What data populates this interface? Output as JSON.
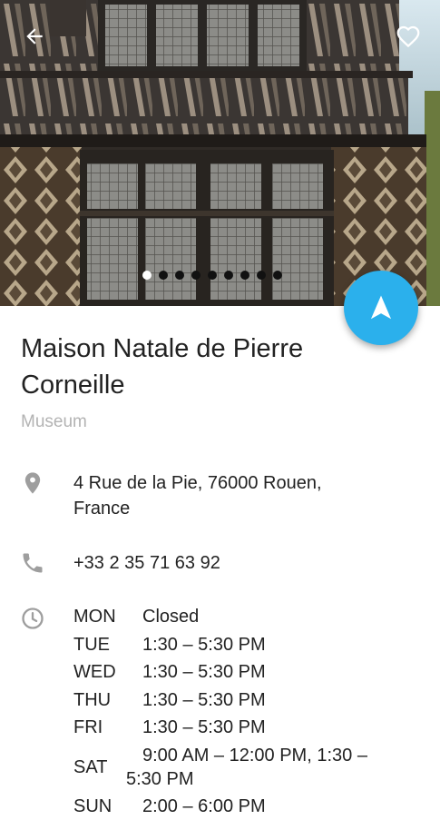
{
  "place": {
    "name": "Maison Natale de Pierre Corneille",
    "category": "Museum"
  },
  "address": "4 Rue de la Pie, 76000 Rouen, France",
  "phone": "+33 2 35 71 63 92",
  "hours": [
    {
      "day": "MON",
      "time": "Closed"
    },
    {
      "day": "TUE",
      "time": "1:30 – 5:30 PM"
    },
    {
      "day": "WED",
      "time": "1:30 – 5:30 PM"
    },
    {
      "day": "THU",
      "time": "1:30 – 5:30 PM"
    },
    {
      "day": "FRI",
      "time": "1:30 – 5:30 PM"
    },
    {
      "day": "SAT",
      "time_line1": "9:00 AM – 12:00 PM, 1:30 –",
      "time_line2": "5:30 PM"
    },
    {
      "day": "SUN",
      "time": "2:00 – 6:00 PM"
    }
  ],
  "gallery": {
    "photo_count": 9,
    "active_index": 0
  },
  "icons": {
    "back": "arrow-back-icon",
    "favorite": "heart-outline-icon",
    "directions": "navigation-arrow-icon",
    "address": "location-pin-icon",
    "phone": "phone-icon",
    "hours": "clock-icon"
  },
  "colors": {
    "accent": "#2bb0ec",
    "secondary_text": "#b3b3b3",
    "icon_gray": "#9e9e9e"
  }
}
